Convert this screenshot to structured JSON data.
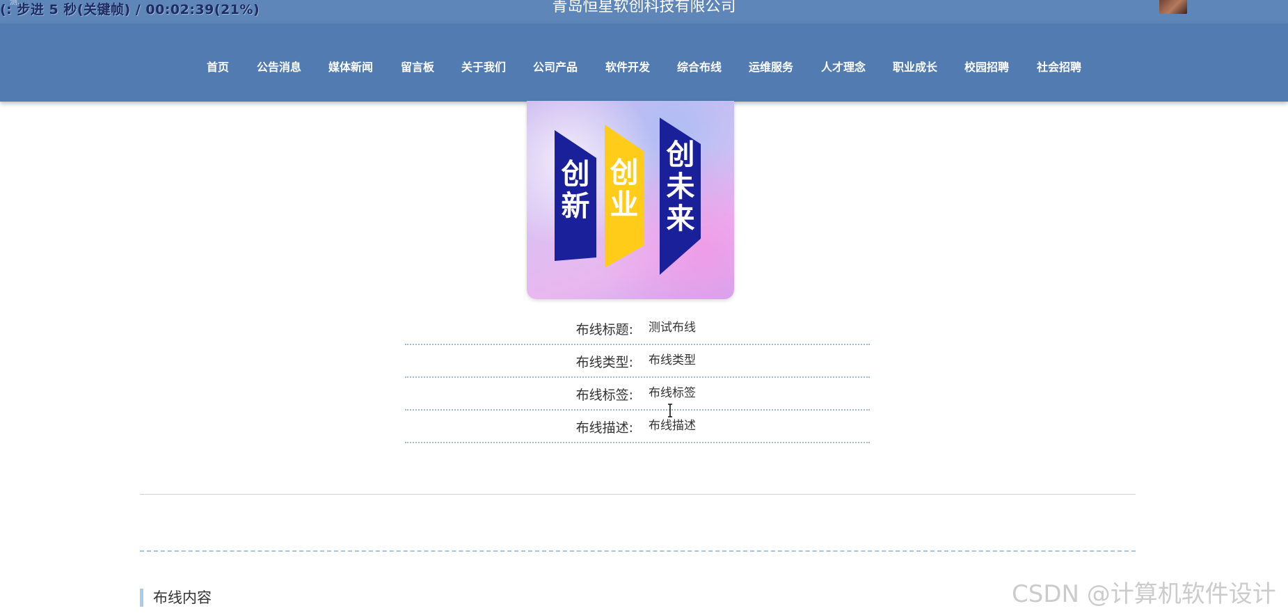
{
  "recording_overlay": {
    "status_text": "(: 步进 5 秒(关键帧) / 00:02:39(21%)",
    "small_text": "测..."
  },
  "header": {
    "company_name": "青岛恒星软创科技有限公司"
  },
  "nav": {
    "items": [
      {
        "label": "首页"
      },
      {
        "label": "公告消息"
      },
      {
        "label": "媒体新闻"
      },
      {
        "label": "留言板"
      },
      {
        "label": "关于我们"
      },
      {
        "label": "公司产品"
      },
      {
        "label": "软件开发"
      },
      {
        "label": "综合布线"
      },
      {
        "label": "运维服务"
      },
      {
        "label": "人才理念"
      },
      {
        "label": "职业成长"
      },
      {
        "label": "校园招聘"
      },
      {
        "label": "社会招聘"
      }
    ]
  },
  "poster": {
    "banner_1": "创新",
    "banner_2": "创业",
    "banner_3": "创未来"
  },
  "details": {
    "title_label": "布线标题:",
    "title_value": "测试布线",
    "type_label": "布线类型:",
    "type_value": "布线类型",
    "tag_label": "布线标签:",
    "tag_value": "布线标签",
    "desc_label": "布线描述:",
    "desc_value": "布线描述"
  },
  "content_section": {
    "title": "布线内容"
  },
  "watermark": "CSDN @计算机软件设计",
  "colors": {
    "topbar": "#5e86b8",
    "navbar": "#527cb1",
    "banner_navy": "#1a1f9a",
    "banner_yellow": "#ffcc1a",
    "divider_dotted": "#9bb8dc"
  }
}
